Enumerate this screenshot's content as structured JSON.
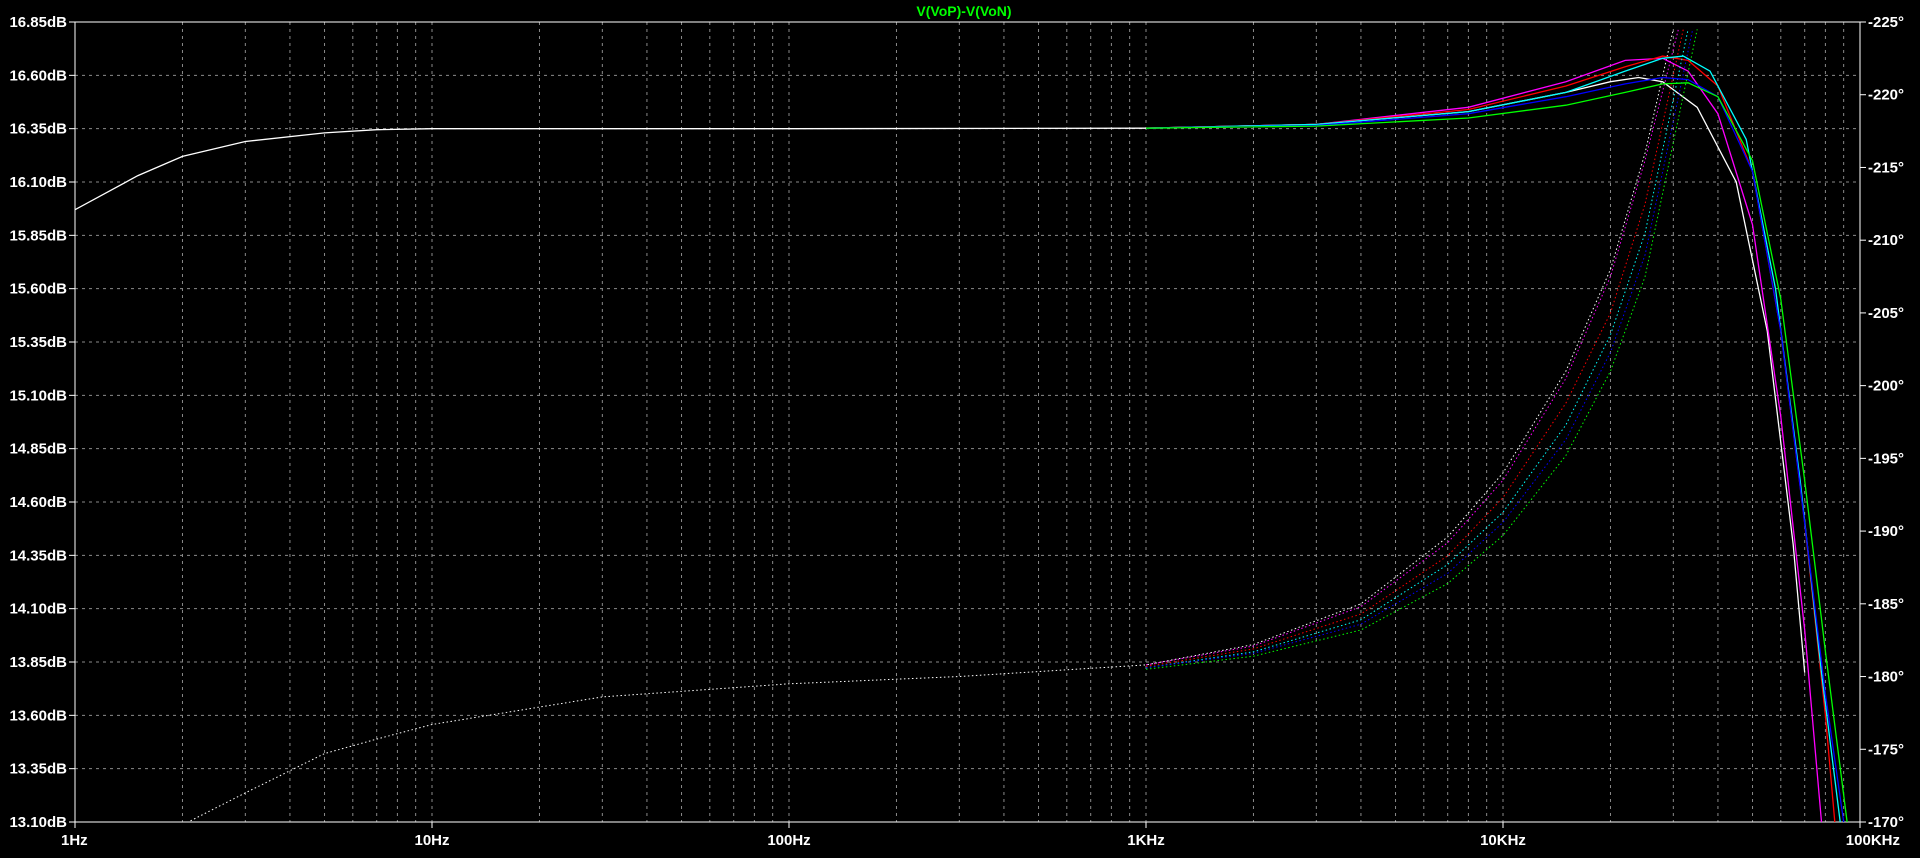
{
  "chart_data": {
    "type": "line",
    "title": "V(VoP)-V(VoN)",
    "title_color": "#00ff00",
    "x_scale": "log",
    "xlim": [
      1,
      100000
    ],
    "x_ticks": [
      1,
      10,
      100,
      1000,
      10000,
      100000
    ],
    "x_tick_labels": [
      "1Hz",
      "10Hz",
      "100Hz",
      "1KHz",
      "10KHz",
      "100KHz"
    ],
    "y_left": {
      "unit": "dB",
      "ylim": [
        13.1,
        16.85
      ],
      "ticks": [
        16.85,
        16.6,
        16.35,
        16.1,
        15.85,
        15.6,
        15.35,
        15.1,
        14.85,
        14.6,
        14.35,
        14.1,
        13.85,
        13.6,
        13.35,
        13.1
      ],
      "tick_labels": [
        "16.85dB",
        "16.60dB",
        "16.35dB",
        "16.10dB",
        "15.85dB",
        "15.60dB",
        "15.35dB",
        "15.10dB",
        "14.85dB",
        "14.60dB",
        "14.35dB",
        "14.10dB",
        "13.85dB",
        "13.60dB",
        "13.35dB",
        "13.10dB"
      ]
    },
    "y_right": {
      "unit": "°",
      "ylim": [
        -225,
        -170
      ],
      "ticks": [
        -170,
        -175,
        -180,
        -185,
        -190,
        -195,
        -200,
        -205,
        -210,
        -215,
        -220,
        -225
      ],
      "tick_labels": [
        "-170°",
        "-175°",
        "-180°",
        "-185°",
        "-190°",
        "-195°",
        "-200°",
        "-205°",
        "-210°",
        "-215°",
        "-220°",
        "-225°"
      ]
    },
    "grid": true,
    "grid_style": "dashed",
    "background": "#000000",
    "series": [
      {
        "color": "#ffffff",
        "magnitude": [
          [
            1,
            15.97
          ],
          [
            1.5,
            16.13
          ],
          [
            2,
            16.22
          ],
          [
            3,
            16.29
          ],
          [
            5,
            16.33
          ],
          [
            7,
            16.345
          ],
          [
            10,
            16.35
          ],
          [
            100,
            16.35
          ],
          [
            1000,
            16.352
          ],
          [
            3000,
            16.37
          ],
          [
            8000,
            16.43
          ],
          [
            15000,
            16.52
          ],
          [
            20000,
            16.57
          ],
          [
            24000,
            16.59
          ],
          [
            28000,
            16.57
          ],
          [
            35000,
            16.45
          ],
          [
            45000,
            16.1
          ],
          [
            55000,
            15.4
          ],
          [
            65000,
            14.4
          ],
          [
            70000,
            13.8
          ]
        ],
        "phase": [
          [
            1,
            -167
          ],
          [
            1.5,
            -168.5
          ],
          [
            2,
            -169.8
          ],
          [
            3,
            -172
          ],
          [
            5,
            -174.7
          ],
          [
            7,
            -175.7
          ],
          [
            10,
            -176.7
          ],
          [
            30,
            -178.6
          ],
          [
            100,
            -179.5
          ],
          [
            300,
            -180.0
          ],
          [
            1000,
            -180.8
          ],
          [
            2000,
            -182.2
          ],
          [
            4000,
            -185.0
          ],
          [
            7000,
            -189.6
          ],
          [
            10000,
            -194.0
          ],
          [
            15000,
            -201.0
          ],
          [
            20000,
            -208.0
          ],
          [
            25000,
            -216.0
          ],
          [
            30000,
            -224.5
          ]
        ]
      },
      {
        "color": "#ff00ff",
        "magnitude": [
          [
            1000,
            16.352
          ],
          [
            3000,
            16.37
          ],
          [
            8000,
            16.45
          ],
          [
            15000,
            16.57
          ],
          [
            22000,
            16.67
          ],
          [
            28000,
            16.68
          ],
          [
            33000,
            16.62
          ],
          [
            40000,
            16.42
          ],
          [
            50000,
            15.9
          ],
          [
            60000,
            15.0
          ],
          [
            70000,
            14.0
          ],
          [
            78000,
            13.1
          ]
        ],
        "phase": [
          [
            1000,
            -180.8
          ],
          [
            2000,
            -182.1
          ],
          [
            4000,
            -184.8
          ],
          [
            7000,
            -189.2
          ],
          [
            10000,
            -193.5
          ],
          [
            15000,
            -200.5
          ],
          [
            20000,
            -207.5
          ],
          [
            25000,
            -215.5
          ],
          [
            31000,
            -224.5
          ]
        ]
      },
      {
        "color": "#ff0000",
        "magnitude": [
          [
            1000,
            16.352
          ],
          [
            3000,
            16.37
          ],
          [
            8000,
            16.44
          ],
          [
            15000,
            16.55
          ],
          [
            22000,
            16.64
          ],
          [
            28000,
            16.69
          ],
          [
            33000,
            16.67
          ],
          [
            40000,
            16.55
          ],
          [
            50000,
            16.15
          ],
          [
            60000,
            15.4
          ],
          [
            70000,
            14.5
          ],
          [
            80000,
            13.6
          ],
          [
            85000,
            13.1
          ]
        ],
        "phase": [
          [
            1000,
            -180.7
          ],
          [
            2000,
            -181.9
          ],
          [
            4000,
            -184.3
          ],
          [
            7000,
            -188.3
          ],
          [
            10000,
            -192.3
          ],
          [
            15000,
            -198.8
          ],
          [
            20000,
            -205.0
          ],
          [
            25000,
            -212.5
          ],
          [
            32000,
            -224.5
          ]
        ]
      },
      {
        "color": "#00ffff",
        "magnitude": [
          [
            1000,
            16.352
          ],
          [
            3000,
            16.37
          ],
          [
            8000,
            16.43
          ],
          [
            15000,
            16.52
          ],
          [
            22000,
            16.62
          ],
          [
            28000,
            16.68
          ],
          [
            32000,
            16.69
          ],
          [
            38000,
            16.62
          ],
          [
            48000,
            16.3
          ],
          [
            58000,
            15.6
          ],
          [
            68000,
            14.7
          ],
          [
            78000,
            13.8
          ],
          [
            88000,
            13.1
          ]
        ],
        "phase": [
          [
            1000,
            -180.6
          ],
          [
            2000,
            -181.7
          ],
          [
            4000,
            -183.9
          ],
          [
            7000,
            -187.7
          ],
          [
            10000,
            -191.3
          ],
          [
            15000,
            -197.3
          ],
          [
            20000,
            -203.5
          ],
          [
            25000,
            -210.5
          ],
          [
            33000,
            -224.5
          ]
        ]
      },
      {
        "color": "#0000ff",
        "magnitude": [
          [
            1000,
            16.352
          ],
          [
            3000,
            16.365
          ],
          [
            8000,
            16.42
          ],
          [
            15000,
            16.5
          ],
          [
            22000,
            16.56
          ],
          [
            28000,
            16.59
          ],
          [
            33000,
            16.58
          ],
          [
            40000,
            16.5
          ],
          [
            50000,
            16.15
          ],
          [
            60000,
            15.4
          ],
          [
            70000,
            14.5
          ],
          [
            80000,
            13.7
          ],
          [
            90000,
            13.1
          ]
        ],
        "phase": [
          [
            1000,
            -180.6
          ],
          [
            2000,
            -181.6
          ],
          [
            4000,
            -183.6
          ],
          [
            7000,
            -187.1
          ],
          [
            10000,
            -190.6
          ],
          [
            15000,
            -196.3
          ],
          [
            20000,
            -202.3
          ],
          [
            25000,
            -209.0
          ],
          [
            34000,
            -224.5
          ]
        ]
      },
      {
        "color": "#00ff00",
        "magnitude": [
          [
            1000,
            16.352
          ],
          [
            3000,
            16.362
          ],
          [
            8000,
            16.4
          ],
          [
            15000,
            16.46
          ],
          [
            22000,
            16.52
          ],
          [
            28000,
            16.56
          ],
          [
            33000,
            16.565
          ],
          [
            40000,
            16.5
          ],
          [
            50000,
            16.2
          ],
          [
            60000,
            15.55
          ],
          [
            70000,
            14.7
          ],
          [
            80000,
            13.9
          ],
          [
            92000,
            13.1
          ]
        ],
        "phase": [
          [
            1000,
            -180.5
          ],
          [
            2000,
            -181.4
          ],
          [
            4000,
            -183.2
          ],
          [
            7000,
            -186.4
          ],
          [
            10000,
            -189.7
          ],
          [
            15000,
            -195.2
          ],
          [
            20000,
            -201.0
          ],
          [
            25000,
            -207.5
          ],
          [
            35000,
            -224.5
          ]
        ]
      }
    ]
  }
}
